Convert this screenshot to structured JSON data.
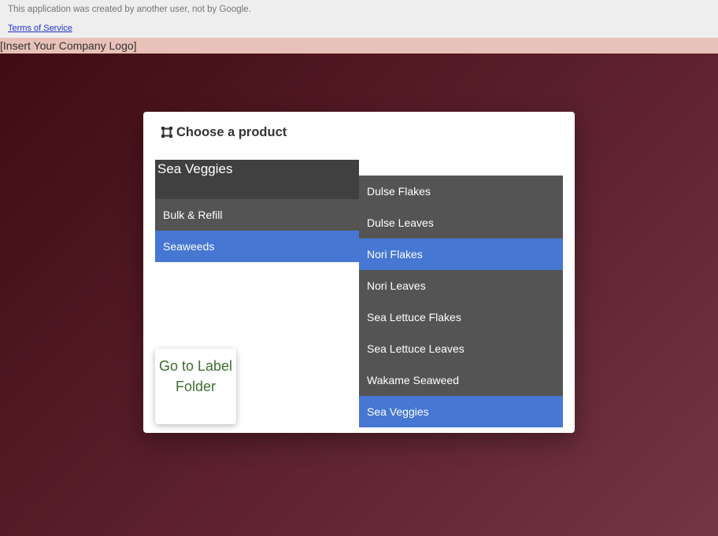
{
  "gbar": {
    "notice": "This application was created by another user, not by Google.",
    "terms_link": "Terms of Service"
  },
  "logo_bar": {
    "text": "[Insert Your Company Logo]"
  },
  "dialog": {
    "title": "Choose a product",
    "title_icon": "product-box-icon"
  },
  "category_list": {
    "header": "Sea Veggies",
    "items": [
      {
        "label": "Bulk & Refill",
        "selected": false
      },
      {
        "label": "Seaweeds",
        "selected": true
      }
    ]
  },
  "product_list": {
    "items": [
      {
        "label": "Dulse Flakes",
        "selected": false
      },
      {
        "label": "Dulse Leaves",
        "selected": false
      },
      {
        "label": "Nori Flakes",
        "selected": true
      },
      {
        "label": "Nori Leaves",
        "selected": false
      },
      {
        "label": "Sea Lettuce Flakes",
        "selected": false
      },
      {
        "label": "Sea Lettuce Leaves",
        "selected": false
      },
      {
        "label": "Wakame Seaweed",
        "selected": false
      },
      {
        "label": "Sea Veggies",
        "selected": true
      }
    ]
  },
  "go_button": {
    "label": "Go to Label Folder"
  },
  "colors": {
    "highlight": "#4677d2",
    "list_bg": "#545454",
    "header_bg": "#404040",
    "button_text": "#3c6e2e",
    "logo_bar_bg": "#e8c2b8"
  }
}
